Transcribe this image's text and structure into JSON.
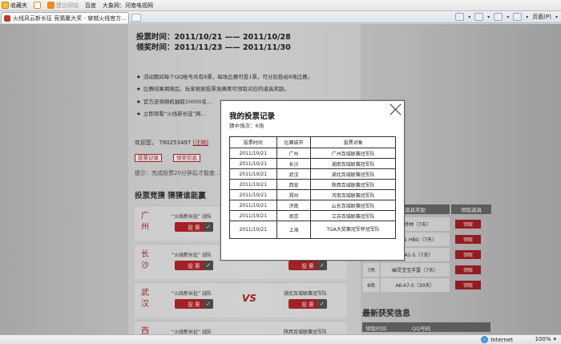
{
  "favorites_bar": {
    "favorites_label": "收藏夹",
    "suggested_sites": "建议网站",
    "baidu": "百度",
    "daxiang": "大象网：河南电视网"
  },
  "tab": {
    "title": "火线风云新长征 竞猜赢大奖 - 穿越火线官方..."
  },
  "toolbar": {
    "page_menu": "页面(P)"
  },
  "page": {
    "vote_time_label": "投票时间：",
    "vote_time_value": "2011/10/21 —— 2011/10/28",
    "claim_time_label": "领奖时间：",
    "claim_time_value": "2011/11/23 —— 2011/11/30",
    "bullets": [
      "活动期间每个QQ账号共有8票，每场比赛可投1票，可分别投给8场比赛。",
      "比赛结果揭晓后，玩家根据投票准确率可领取对应的道具奖励。",
      "官方还将随机抽取10000名…",
      "立即观看“火线新长征”网…"
    ],
    "welcome_label": "欢迎您，",
    "welcome_qq": "780253497",
    "logout": "[注销]",
    "btn_my_votes": "投票记录",
    "btn_prize": "领奖信息",
    "tip": "提示：完成投票20分钟后才能查…",
    "section_title": "投票竞猜  猜猜谁能赢",
    "matches": [
      {
        "city": "广州",
        "team": "“火线新长征” 战队",
        "vote": "投 票"
      },
      {
        "city": "长沙",
        "team": "“火线新长征” 战队",
        "vote": "投 票",
        "opponent_vote": "投 票"
      },
      {
        "city": "武汉",
        "team": "“火线新长征” 战队",
        "vote": "投 票",
        "vs": "VS",
        "opponent": "湖北百城联赛冠军队",
        "opponent_vote": "投 票"
      },
      {
        "city": "西安",
        "team": "“火线新长征” 战队",
        "opponent": "陕西百城联赛冠军队"
      }
    ],
    "reward_header": [
      "道具奖励",
      "领取道具"
    ],
    "rewards": [
      {
        "count": "",
        "item": "加特林（7天）",
        "action": "领取"
      },
      {
        "count": "",
        "item": "M4A1 HBG（7天）",
        "action": "领取"
      },
      {
        "count": "",
        "item": "M4A1-S（7天）",
        "action": "领取"
      },
      {
        "count": "7场",
        "item": "幽灵宝宝手雷（7天）",
        "action": "领取"
      },
      {
        "count": "8场",
        "item": "AK-47-S（30天）",
        "action": "领取"
      }
    ],
    "latest_title": "最新获奖信息",
    "latest_header": [
      "领取时间",
      "QQ号码"
    ]
  },
  "modal": {
    "title": "我的投票记录",
    "subtitle": "猜中场次：6场",
    "columns": [
      "投票时间",
      "比赛城市",
      "投票对象"
    ],
    "rows": [
      [
        "2011/10/21",
        "广州",
        "广州百城联赛冠军队"
      ],
      [
        "2011/10/21",
        "长沙",
        "湖南百城联赛冠军队"
      ],
      [
        "2011/10/21",
        "武汉",
        "湖北百城联赛冠军队"
      ],
      [
        "2011/10/21",
        "西安",
        "陕西百城联赛冠军队"
      ],
      [
        "2011/10/21",
        "郑州",
        "河南百城联赛冠军队"
      ],
      [
        "2011/10/21",
        "济南",
        "山东百城联赛冠军队"
      ],
      [
        "2011/10/21",
        "南京",
        "江苏百城联赛冠军队"
      ],
      [
        "2011/10/21",
        "上海",
        "TGA大奖赛冠军杯冠军队"
      ]
    ]
  },
  "status": {
    "zone": "Internet",
    "zoom": "100%"
  }
}
